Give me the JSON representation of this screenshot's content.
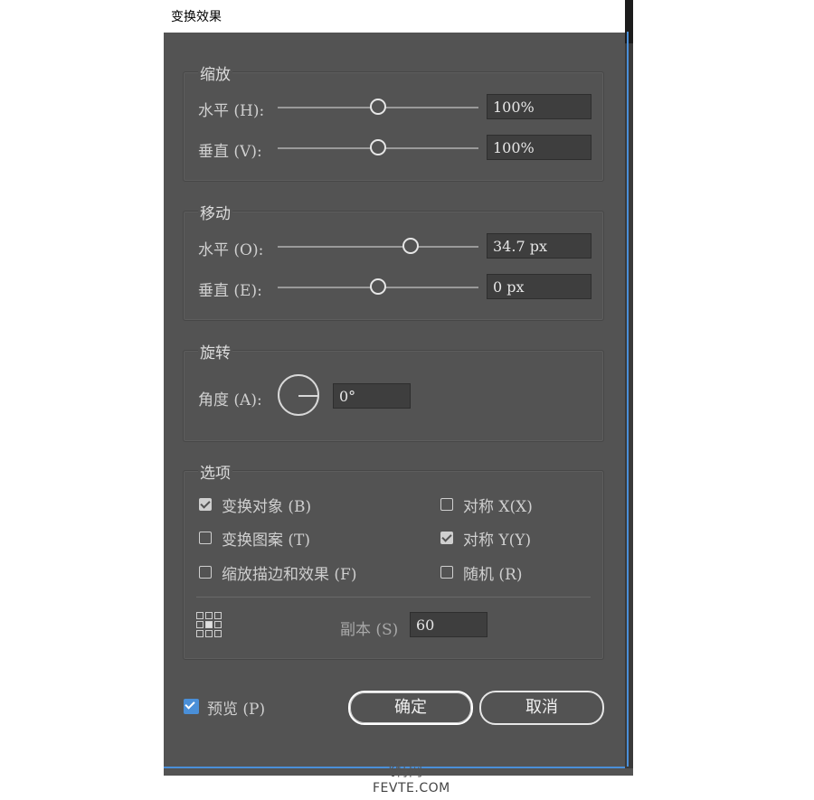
{
  "window": {
    "title": "变换效果"
  },
  "scale": {
    "title": "缩放",
    "horizontal": {
      "label": "水平 (H):",
      "value": "100%",
      "slider_fraction": 0.5
    },
    "vertical": {
      "label": "垂直 (V):",
      "value": "100%",
      "slider_fraction": 0.5
    }
  },
  "move": {
    "title": "移动",
    "horizontal": {
      "label": "水平 (O):",
      "value": "34.7 px",
      "slider_fraction": 0.66
    },
    "vertical": {
      "label": "垂直 (E):",
      "value": "0 px",
      "slider_fraction": 0.5
    }
  },
  "rotate": {
    "title": "旋转",
    "angle": {
      "label": "角度 (A):",
      "value": "0°"
    }
  },
  "options": {
    "title": "选项",
    "transform_objects": {
      "label": "变换对象 (B)",
      "checked": true
    },
    "transform_patterns": {
      "label": "变换图案 (T)",
      "checked": false
    },
    "scale_strokes": {
      "label": "缩放描边和效果 (F)",
      "checked": false
    },
    "reflect_x": {
      "label": "对称 X(X)",
      "checked": false
    },
    "reflect_y": {
      "label": "对称 Y(Y)",
      "checked": true
    },
    "random": {
      "label": "随机 (R)",
      "checked": false
    },
    "copies": {
      "label": "副本 (S)",
      "value": "60"
    }
  },
  "footer": {
    "preview": {
      "label": "预览 (P)",
      "checked": true
    },
    "ok_label": "确定",
    "cancel_label": "取消"
  },
  "watermark": {
    "line1": "飞特网",
    "line2": "FEVTE.COM"
  },
  "colors": {
    "panel": "#535353",
    "accent": "#4a8fd8"
  }
}
